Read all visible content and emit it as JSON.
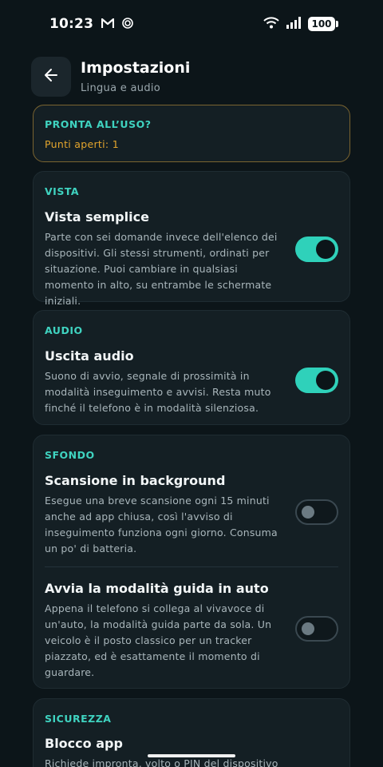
{
  "status_bar": {
    "time": "10:23",
    "battery": "100"
  },
  "header": {
    "title": "Impostazioni",
    "subtitle": "Lingua e audio"
  },
  "ready_card": {
    "title": "PRONTA ALL’USO?",
    "subtitle": "Punti aperti: 1"
  },
  "vista": {
    "section": "VISTA",
    "title": "Vista semplice",
    "desc": "Parte con sei domande invece dell'elenco dei dispositivi. Gli stessi strumenti, ordinati per situazione. Puoi cambiare in qualsiasi momento in alto, su entrambe le schermate iniziali.",
    "enabled": true
  },
  "audio": {
    "section": "AUDIO",
    "title": "Uscita audio",
    "desc": "Suono di avvio, segnale di prossimità in modalità inseguimento e avvisi. Resta muto finché il telefono è in modalità silenziosa.",
    "enabled": true
  },
  "sfondo": {
    "section": "SFONDO",
    "items": [
      {
        "title": "Scansione in background",
        "desc": "Esegue una breve scansione ogni 15 minuti anche ad app chiusa, così l'avviso di inseguimento funziona ogni giorno. Consuma un po' di batteria.",
        "enabled": false
      },
      {
        "title": "Avvia la modalità guida in auto",
        "desc": "Appena il telefono si collega al vivavoce di un'auto, la modalità guida parte da sola. Un veicolo è il posto classico per un tracker piazzato, ed è esattamente il momento di guardare.",
        "enabled": false
      }
    ]
  },
  "sicurezza": {
    "section": "SICUREZZA",
    "title": "Blocco app",
    "desc": "Richiede impronta, volto o PIN del dispositivo"
  },
  "colors": {
    "accent": "#2fd1ba",
    "warning": "#e3a52d",
    "background": "#0c1519"
  }
}
